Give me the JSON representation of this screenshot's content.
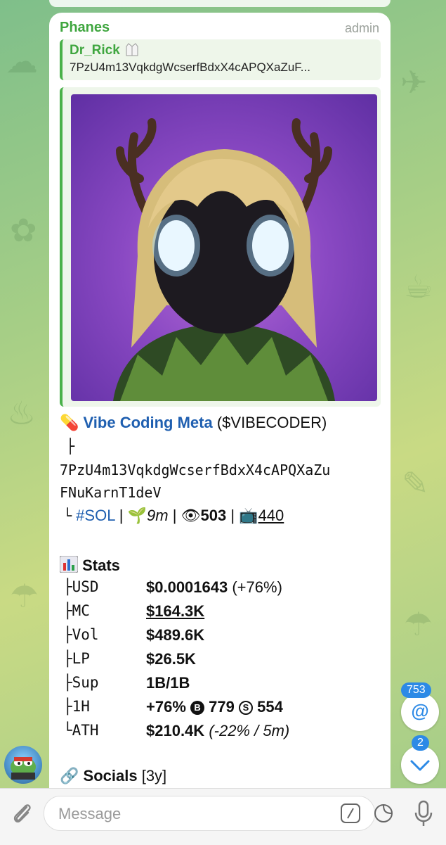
{
  "message": {
    "sender": "Phanes",
    "role": "admin",
    "reply": {
      "name": "Dr_Rick",
      "text": "7PzU4m13VqkdgWcserfBdxX4cAPQXaZuF..."
    },
    "token": {
      "name": "Vibe Coding Meta",
      "ticker": "($VIBECODER)",
      "tree_top": "├",
      "address_line1": "7PzU4m13VqkdgWcserfBdxX4cAPQXaZu",
      "address_line2": "FNuKarnT1deV",
      "chain": "#SOL",
      "age": "9m",
      "views": "503",
      "tv": "440",
      "sep": "|"
    },
    "stats": {
      "title": "Stats",
      "rows": [
        {
          "key": "├USD",
          "value": "$0.0001643",
          "extra": "(+76%)"
        },
        {
          "key": "├MC",
          "value": "$164.3K",
          "extra": ""
        },
        {
          "key": "├Vol",
          "value": "$489.6K",
          "extra": ""
        },
        {
          "key": "├LP",
          "value": "$26.5K",
          "extra": ""
        },
        {
          "key": "├Sup",
          "value": "1B/1B",
          "extra": ""
        },
        {
          "key": "├1H",
          "value": "+76%",
          "extra": ""
        },
        {
          "key": "└ATH",
          "value": "$210.4K",
          "extra": "(-22% / 5m)"
        }
      ],
      "buys": "779",
      "sells": "554",
      "buy_glyph": "B",
      "sell_glyph": "S"
    },
    "socials": {
      "title": "Socials",
      "age": "[3y]"
    }
  },
  "floating": {
    "mentions_count": "753",
    "mention_symbol": "@",
    "unread_count": "2"
  },
  "composer": {
    "placeholder": "Message"
  },
  "colors": {
    "sender": "#3fa63f",
    "link": "#1f5fb0",
    "badge": "#2d8ae6"
  }
}
